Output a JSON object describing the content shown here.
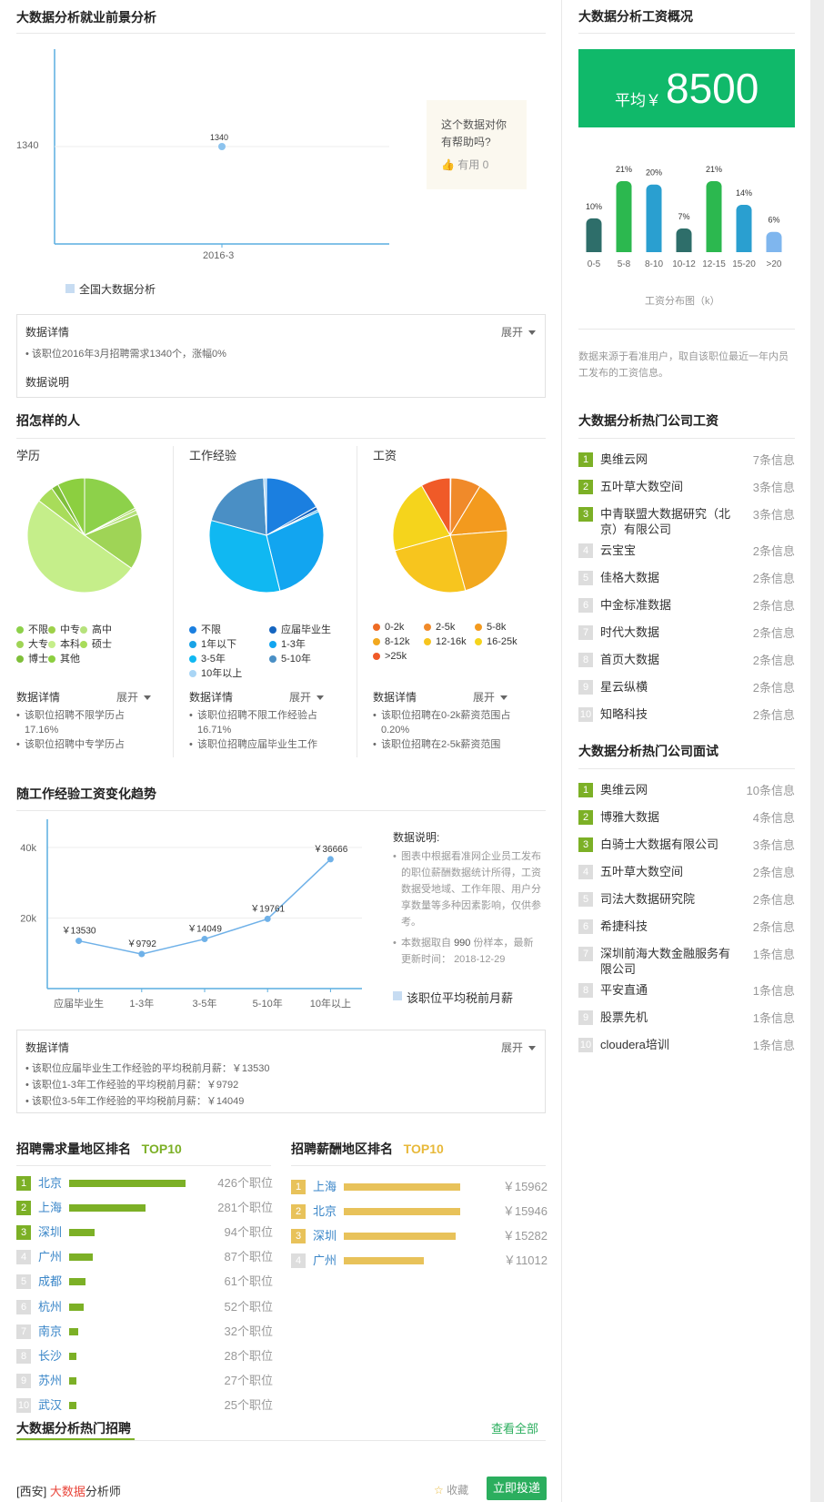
{
  "outlook": {
    "title": "大数据分析就业前景分析",
    "y_tick": "1340",
    "point_label": "1340",
    "x_tick": "2016-3",
    "legend": "全国大数据分析",
    "helpful_question": "这个数据对你有帮助吗?",
    "helpful_button": "有用 0",
    "details_title": "数据详情",
    "expand": "展开",
    "detail_line": "该职位2016年3月招聘需求1340个，涨幅0%",
    "explain": "数据说明"
  },
  "people": {
    "title": "招怎样的人",
    "education": {
      "title": "学历",
      "legend": [
        "不限",
        "中专",
        "高中",
        "大专",
        "本科",
        "硕士",
        "博士",
        "其他"
      ],
      "colors": [
        "#8dd14a",
        "#9ed14a",
        "#b6e27c",
        "#9fd456",
        "#c5ee8a",
        "#a8dc5a",
        "#7fbf3a",
        "#8ccf40"
      ],
      "values": [
        17.16,
        0.6,
        1.2,
        15.8,
        50.5,
        5.0,
        2.0,
        7.7
      ],
      "details_title": "数据详情",
      "expand": "展开",
      "lines": [
        "该职位招聘不限学历占17.16%",
        "该职位招聘中专学历占"
      ]
    },
    "experience": {
      "title": "工作经验",
      "legend": [
        "不限",
        "应届毕业生",
        "1年以下",
        "1-3年",
        "3-5年",
        "5-10年",
        "10年以上"
      ],
      "colors": [
        "#1b7fe0",
        "#1565c0",
        "#19a3e6",
        "#12a5f0",
        "#10b8f2",
        "#4a8fc5",
        "#a9d5f5"
      ],
      "values": [
        16.71,
        1.0,
        0.5,
        28.0,
        33.0,
        20.0,
        0.8
      ],
      "details_title": "数据详情",
      "expand": "展开",
      "lines": [
        "该职位招聘不限工作经验占16.71%",
        "该职位招聘应届毕业生工作"
      ]
    },
    "salary": {
      "title": "工资",
      "legend": [
        "0-2k",
        "2-5k",
        "5-8k",
        "8-12k",
        "12-16k",
        "16-25k",
        ">25k"
      ],
      "colors": [
        "#ee6b24",
        "#f08a2a",
        "#f39a1e",
        "#f2a81f",
        "#f7c51e",
        "#f5d41c",
        "#f05a28"
      ],
      "values": [
        0.2,
        8.5,
        15.0,
        22.0,
        25.0,
        21.0,
        8.3
      ],
      "details_title": "数据详情",
      "expand": "展开",
      "lines": [
        "该职位招聘在0-2k薪资范围占0.20%",
        "该职位招聘在2-5k薪资范围"
      ]
    }
  },
  "trend": {
    "title": "随工作经验工资变化趋势",
    "note_title": "数据说明:",
    "note_1": "图表中根据看准网企业员工发布的职位薪酬数据统计所得，工资数据受地域、工作年限、用户分享数量等多种因素影响，仅供参考。",
    "note_2_prefix": "本数据取自",
    "note_2_count": "990",
    "note_2_suffix": "份样本，最新更新时间：",
    "note_2_date": "2018-12-29",
    "legend": "该职位平均税前月薪",
    "details_title": "数据详情",
    "expand": "展开",
    "lines": [
      "该职位应届毕业生工作经验的平均税前月薪：￥13530",
      "该职位1-3年工作经验的平均税前月薪：￥9792",
      "该职位3-5年工作经验的平均税前月薪：￥14049"
    ]
  },
  "chart_data": {
    "type": "line",
    "categories": [
      "应届毕业生",
      "1-3年",
      "3-5年",
      "5-10年",
      "10年以上"
    ],
    "values": [
      13530,
      9792,
      14049,
      19761,
      36666
    ],
    "labels": [
      "￥13530",
      "￥9792",
      "￥14049",
      "￥19761",
      "￥36666"
    ],
    "y_ticks": [
      "20k",
      "40k"
    ],
    "ylim": [
      0,
      48000
    ],
    "series": [
      {
        "name": "该职位平均税前月薪",
        "values": [
          13530,
          9792,
          14049,
          19761,
          36666
        ]
      }
    ]
  },
  "demand_rank": {
    "title": "招聘需求量地区排名",
    "tag": "TOP10",
    "rows": [
      {
        "rank": "1",
        "city": "北京",
        "value": 426,
        "text": "426个职位"
      },
      {
        "rank": "2",
        "city": "上海",
        "value": 281,
        "text": "281个职位"
      },
      {
        "rank": "3",
        "city": "深圳",
        "value": 94,
        "text": "94个职位"
      },
      {
        "rank": "4",
        "city": "广州",
        "value": 87,
        "text": "87个职位"
      },
      {
        "rank": "5",
        "city": "成都",
        "value": 61,
        "text": "61个职位"
      },
      {
        "rank": "6",
        "city": "杭州",
        "value": 52,
        "text": "52个职位"
      },
      {
        "rank": "7",
        "city": "南京",
        "value": 32,
        "text": "32个职位"
      },
      {
        "rank": "8",
        "city": "长沙",
        "value": 28,
        "text": "28个职位"
      },
      {
        "rank": "9",
        "city": "苏州",
        "value": 27,
        "text": "27个职位"
      },
      {
        "rank": "10",
        "city": "武汉",
        "value": 25,
        "text": "25个职位"
      }
    ]
  },
  "salary_rank": {
    "title": "招聘薪酬地区排名",
    "tag": "TOP10",
    "rows": [
      {
        "rank": "1",
        "city": "上海",
        "value": 15962,
        "text": "￥15962"
      },
      {
        "rank": "2",
        "city": "北京",
        "value": 15946,
        "text": "￥15946"
      },
      {
        "rank": "3",
        "city": "深圳",
        "value": 15282,
        "text": "￥15282"
      },
      {
        "rank": "4",
        "city": "广州",
        "value": 11012,
        "text": "￥11012"
      }
    ]
  },
  "hot_jobs": {
    "title": "大数据分析热门招聘",
    "view_all": "查看全部",
    "job_city": "[西安]",
    "job_highlight": "大数据",
    "job_rest": "分析师",
    "collect": "收藏",
    "apply": "立即投递"
  },
  "salary_overview": {
    "title": "大数据分析工资概况",
    "avg_label": "平均￥",
    "avg_value": "8500",
    "hist_caption": "工资分布图（k）",
    "bins": [
      "0-5",
      "5-8",
      "8-10",
      "10-12",
      "12-15",
      "15-20",
      ">20"
    ],
    "percents": [
      10,
      21,
      20,
      7,
      21,
      14,
      6
    ],
    "percent_labels": [
      "10%",
      "21%",
      "20%",
      "7%",
      "21%",
      "14%",
      "6%"
    ],
    "bar_colors": [
      "#2e6e6a",
      "#2cb84f",
      "#2a9fd0",
      "#2e6e6a",
      "#2cb84f",
      "#2a9fd0",
      "#7fb6ee"
    ],
    "source_note": "数据来源于看准用户，取自该职位最近一年内员工发布的工资信息。"
  },
  "hot_salary": {
    "title": "大数据分析热门公司工资",
    "rows": [
      {
        "rank": "1",
        "name": "奥维云网",
        "count": "7条信息"
      },
      {
        "rank": "2",
        "name": "五叶草大数空间",
        "count": "3条信息"
      },
      {
        "rank": "3",
        "name": "中青联盟大数据研究（北京）有限公司",
        "count": "3条信息"
      },
      {
        "rank": "4",
        "name": "云宝宝",
        "count": "2条信息"
      },
      {
        "rank": "5",
        "name": "佳格大数据",
        "count": "2条信息"
      },
      {
        "rank": "6",
        "name": "中金标准数据",
        "count": "2条信息"
      },
      {
        "rank": "7",
        "name": "时代大数据",
        "count": "2条信息"
      },
      {
        "rank": "8",
        "name": "首页大数据",
        "count": "2条信息"
      },
      {
        "rank": "9",
        "name": "星云纵横",
        "count": "2条信息"
      },
      {
        "rank": "10",
        "name": "知略科技",
        "count": "2条信息"
      }
    ]
  },
  "hot_interview": {
    "title": "大数据分析热门公司面试",
    "rows": [
      {
        "rank": "1",
        "name": "奥维云网",
        "count": "10条信息"
      },
      {
        "rank": "2",
        "name": "博雅大数据",
        "count": "4条信息"
      },
      {
        "rank": "3",
        "name": "白骑士大数据有限公司",
        "count": "3条信息"
      },
      {
        "rank": "4",
        "name": "五叶草大数空间",
        "count": "2条信息"
      },
      {
        "rank": "5",
        "name": "司法大数据研究院",
        "count": "2条信息"
      },
      {
        "rank": "6",
        "name": "希捷科技",
        "count": "2条信息"
      },
      {
        "rank": "7",
        "name": "深圳前海大数金融服务有限公司",
        "count": "1条信息"
      },
      {
        "rank": "8",
        "name": "平安直通",
        "count": "1条信息"
      },
      {
        "rank": "9",
        "name": "股票先机",
        "count": "1条信息"
      },
      {
        "rank": "10",
        "name": "cloudera培训",
        "count": "1条信息"
      }
    ]
  }
}
